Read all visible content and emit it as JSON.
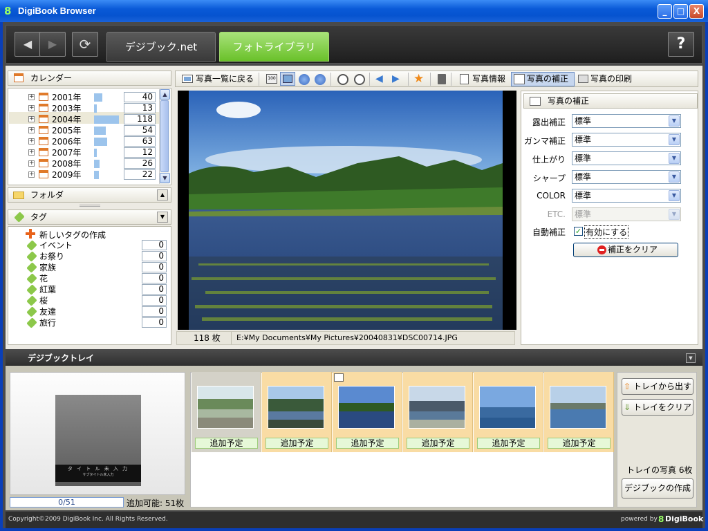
{
  "window": {
    "title": "DigiBook Browser",
    "minimize": "_",
    "maximize": "□",
    "close": "X"
  },
  "header": {
    "back_icon": "◀",
    "forward_icon": "▶",
    "refresh_icon": "⟳",
    "tab_net": "デジブック.net",
    "tab_photo": "フォトライブラリ",
    "help": "?"
  },
  "calendar": {
    "title": "カレンダー",
    "years": [
      {
        "label": "2001年",
        "count": "40",
        "bar": 0.34
      },
      {
        "label": "2003年",
        "count": "13",
        "bar": 0.11
      },
      {
        "label": "2004年",
        "count": "118",
        "bar": 1.0
      },
      {
        "label": "2005年",
        "count": "54",
        "bar": 0.46
      },
      {
        "label": "2006年",
        "count": "63",
        "bar": 0.53
      },
      {
        "label": "2007年",
        "count": "12",
        "bar": 0.1
      },
      {
        "label": "2008年",
        "count": "26",
        "bar": 0.22
      },
      {
        "label": "2009年",
        "count": "22",
        "bar": 0.19
      }
    ]
  },
  "folder": {
    "title": "フォルダ"
  },
  "tags": {
    "title": "タグ",
    "new_tag": "新しいタグの作成",
    "items": [
      {
        "label": "イベント",
        "count": "0"
      },
      {
        "label": "お祭り",
        "count": "0"
      },
      {
        "label": "家族",
        "count": "0"
      },
      {
        "label": "花",
        "count": "0"
      },
      {
        "label": "紅葉",
        "count": "0"
      },
      {
        "label": "桜",
        "count": "0"
      },
      {
        "label": "友達",
        "count": "0"
      },
      {
        "label": "旅行",
        "count": "0"
      }
    ]
  },
  "toolbar": {
    "back_list": "写真一覧に戻る",
    "info": "写真情報",
    "correct": "写真の補正",
    "print": "写真の印刷"
  },
  "status": {
    "count": "118 枚",
    "path": "E:¥My Documents¥My Pictures¥20040831¥DSC00714.JPG"
  },
  "correction": {
    "title": "写真の補正",
    "rows": [
      {
        "label": "露出補正",
        "value": "標準"
      },
      {
        "label": "ガンマ補正",
        "value": "標準"
      },
      {
        "label": "仕上がり",
        "value": "標準"
      },
      {
        "label": "シャープ",
        "value": "標準"
      },
      {
        "label": "COLOR",
        "value": "標準"
      },
      {
        "label": "ETC.",
        "value": "標準"
      }
    ],
    "auto_label": "自動補正",
    "auto_checkbox": "有効にする",
    "clear_button": "補正をクリア"
  },
  "tray": {
    "title": "デジブックトレイ",
    "book_title": "タ イ ト ル 未 入 力",
    "book_subtitle": "サブタイトル未入力",
    "progress": "0/51",
    "available": "追加可能: 51枚",
    "thumbs": [
      {
        "label": "追加予定"
      },
      {
        "label": "追加予定"
      },
      {
        "label": "追加予定"
      },
      {
        "label": "追加予定"
      },
      {
        "label": "追加予定"
      },
      {
        "label": "追加予定"
      }
    ],
    "remove_button": "トレイから出す",
    "clear_button": "トレイをクリア",
    "count_text": "トレイの写真 6枚",
    "create_button": "デジブックの作成"
  },
  "footer": {
    "copyright": "Copyright©2009 DigiBook Inc. All Rights Reserved.",
    "powered": "powered by",
    "brand": "DigiBook"
  }
}
